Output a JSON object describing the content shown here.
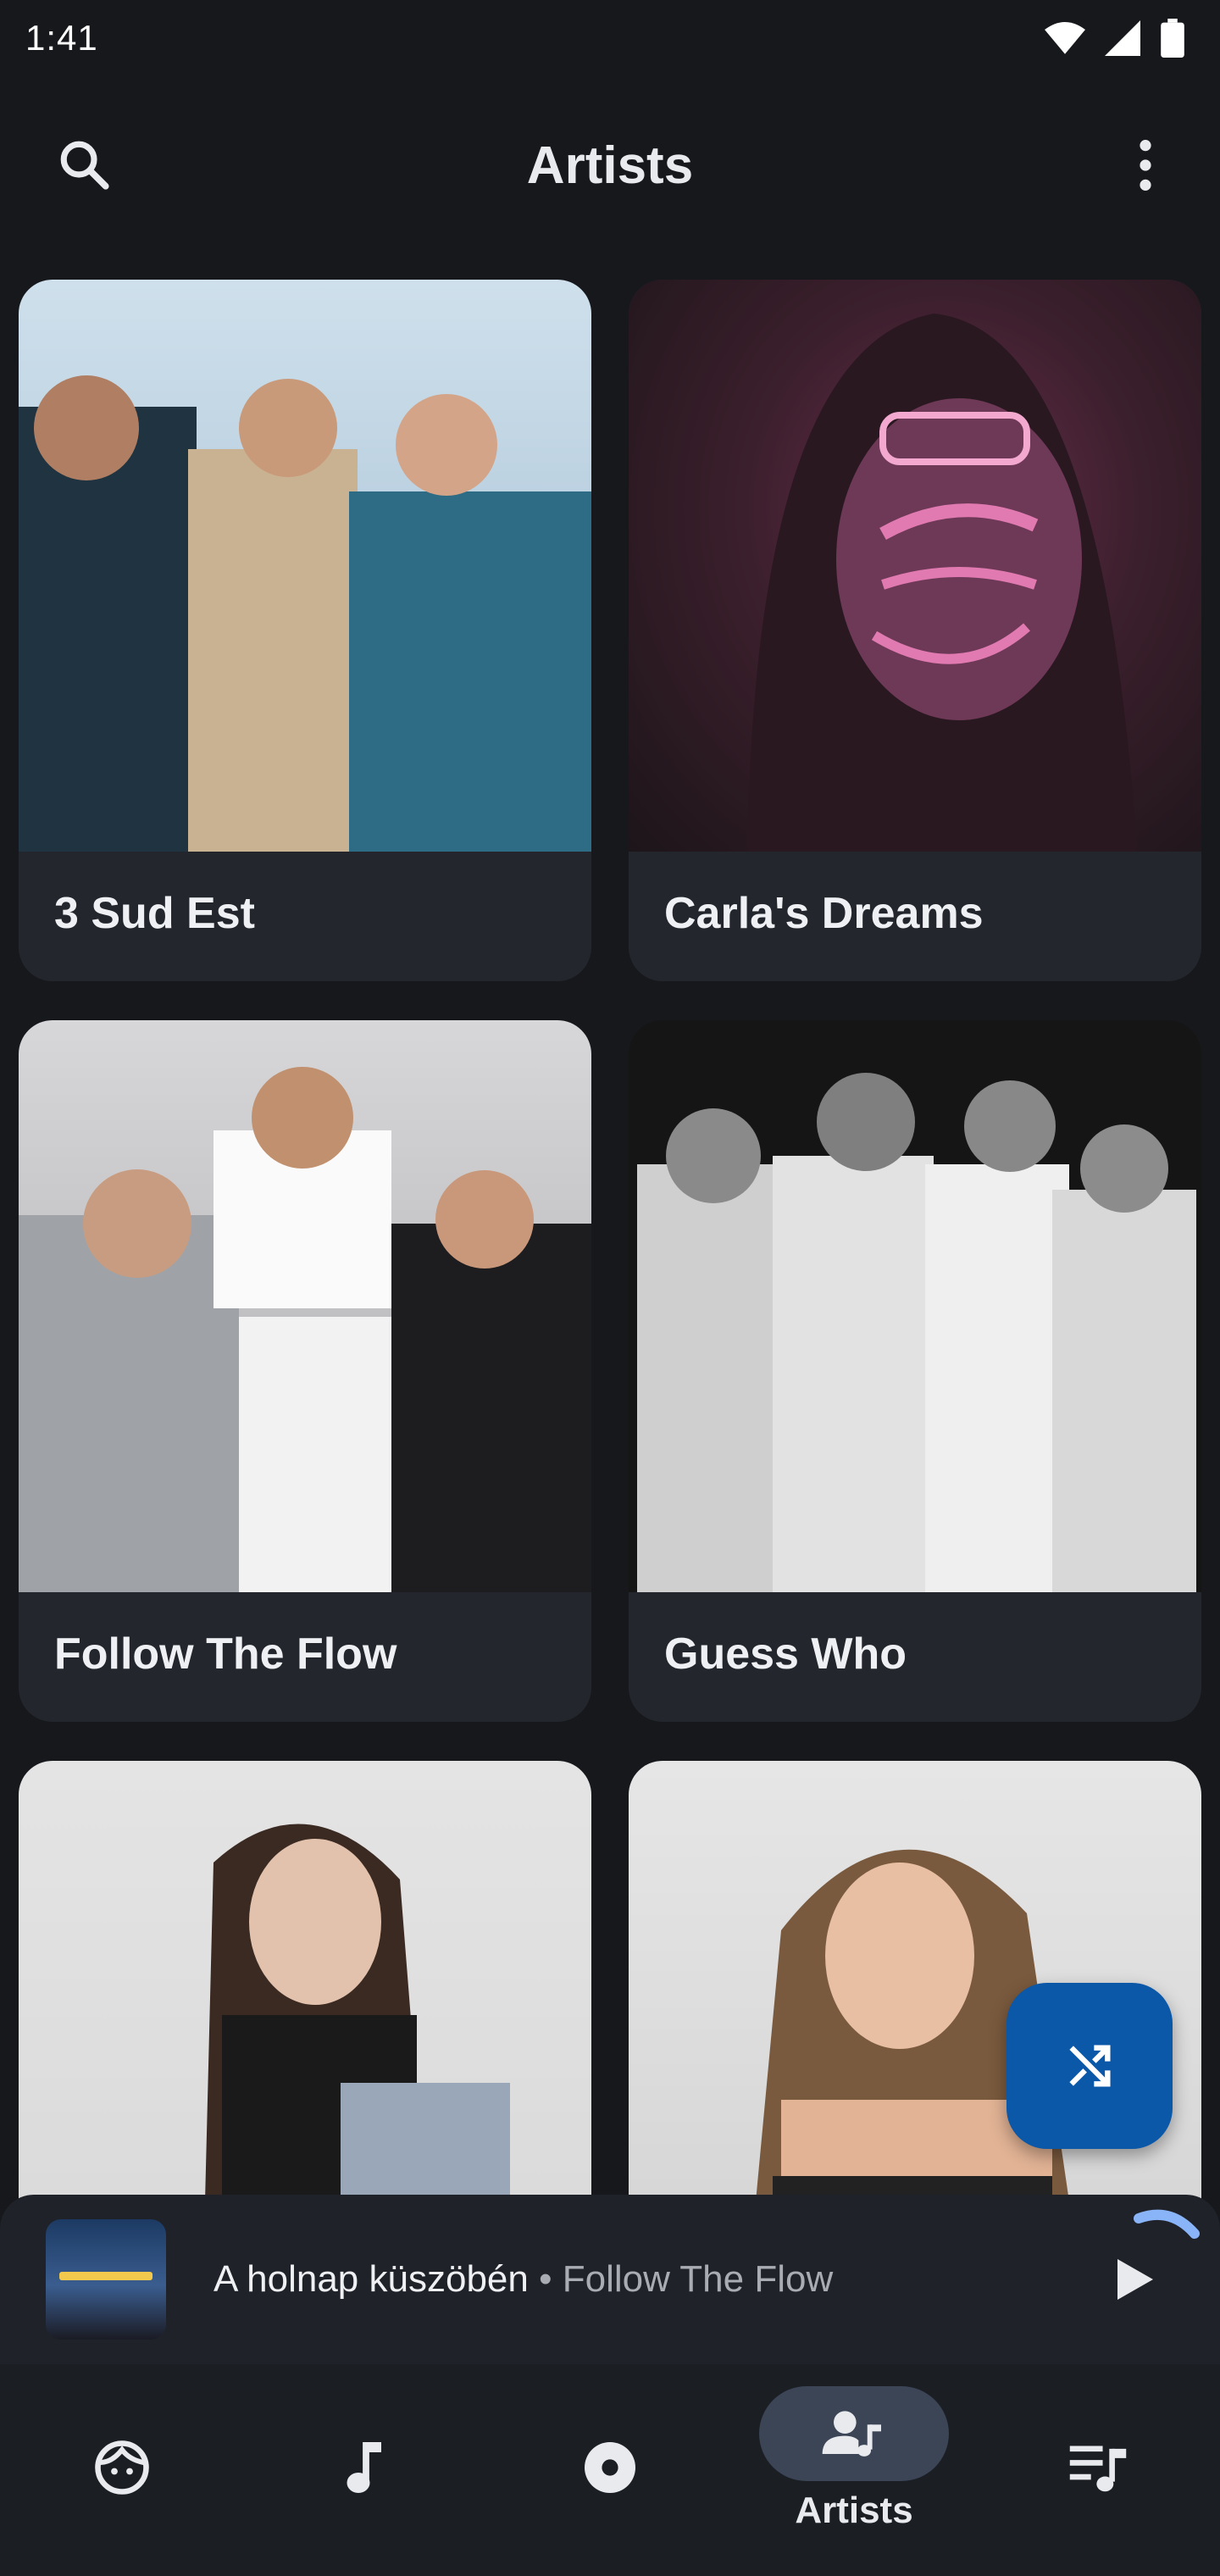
{
  "status_bar": {
    "time": "1:41",
    "icons": [
      "wifi-icon",
      "signal-icon",
      "battery-icon"
    ]
  },
  "app_bar": {
    "title": "Artists",
    "left_icon": "search-icon",
    "right_icon": "more-vert-icon"
  },
  "artists": [
    {
      "name": "3 Sud Est"
    },
    {
      "name": "Carla's Dreams"
    },
    {
      "name": "Follow The Flow"
    },
    {
      "name": "Guess Who"
    },
    {
      "name": ""
    },
    {
      "name": ""
    }
  ],
  "fab": {
    "icon": "shuffle-icon"
  },
  "mini_player": {
    "song": "A holnap küszöbén",
    "separator": " • ",
    "artist": "Follow The Flow",
    "play_icon": "play-icon"
  },
  "bottom_nav": {
    "items": [
      {
        "icon": "face-icon",
        "label": ""
      },
      {
        "icon": "music-note-icon",
        "label": ""
      },
      {
        "icon": "album-icon",
        "label": ""
      },
      {
        "icon": "artist-icon",
        "label": "Artists"
      },
      {
        "icon": "queue-music-icon",
        "label": ""
      }
    ],
    "active_index": 3
  },
  "colors": {
    "background": "#16181c",
    "card": "#23262d",
    "fab": "#0b57a8",
    "accent_progress": "#8ab4f8",
    "nav_active_pill": "#3b4556"
  }
}
